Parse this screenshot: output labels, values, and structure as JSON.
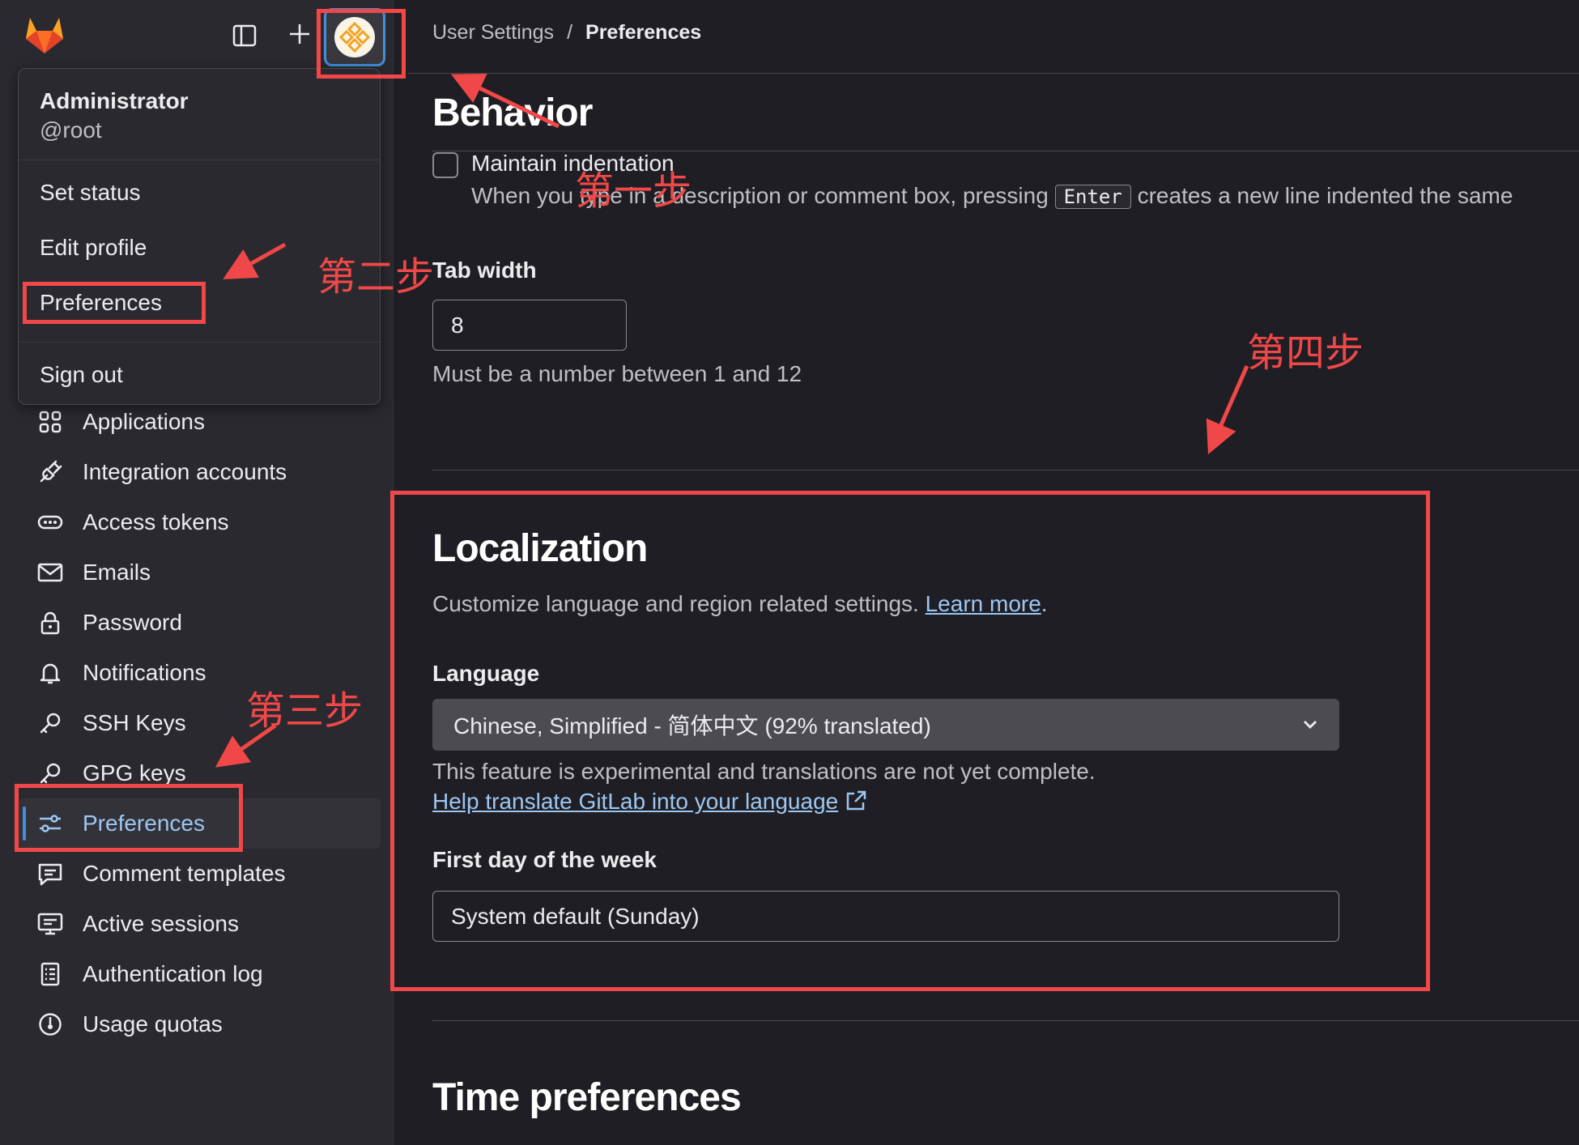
{
  "breadcrumb": {
    "parent": "User Settings",
    "separator": "/",
    "current": "Preferences"
  },
  "user_menu": {
    "name": "Administrator",
    "username": "@root",
    "items": [
      "Set status",
      "Edit profile",
      "Preferences",
      "Sign out"
    ]
  },
  "sidebar": {
    "items": [
      {
        "label": "Applications",
        "icon": "applications-icon"
      },
      {
        "label": "Integration accounts",
        "icon": "plug-icon"
      },
      {
        "label": "Access tokens",
        "icon": "token-icon"
      },
      {
        "label": "Emails",
        "icon": "mail-icon"
      },
      {
        "label": "Password",
        "icon": "lock-icon"
      },
      {
        "label": "Notifications",
        "icon": "bell-icon"
      },
      {
        "label": "SSH Keys",
        "icon": "key-icon"
      },
      {
        "label": "GPG keys",
        "icon": "key-icon"
      },
      {
        "label": "Preferences",
        "icon": "preferences-icon",
        "active": true
      },
      {
        "label": "Comment templates",
        "icon": "comment-icon"
      },
      {
        "label": "Active sessions",
        "icon": "monitor-icon"
      },
      {
        "label": "Authentication log",
        "icon": "log-icon"
      },
      {
        "label": "Usage quotas",
        "icon": "quota-icon"
      }
    ]
  },
  "behavior": {
    "title": "Behavior",
    "maintain_indentation": {
      "label": "Maintain indentation",
      "checked": false,
      "help_before": "When you type in a description or comment box, pressing",
      "key": "Enter",
      "help_after": "creates a new line indented the same"
    },
    "tab_width": {
      "label": "Tab width",
      "value": "8",
      "help": "Must be a number between 1 and 12"
    }
  },
  "localization": {
    "title": "Localization",
    "description": "Customize language and region related settings.",
    "learn_more": "Learn more",
    "period": ".",
    "language": {
      "label": "Language",
      "selected": "Chinese, Simplified - 简体中文 (92% translated)",
      "note": "This feature is experimental and translations are not yet complete.",
      "help_link": "Help translate GitLab into your language"
    },
    "first_day": {
      "label": "First day of the week",
      "selected": "System default (Sunday)"
    }
  },
  "time_preferences": {
    "title": "Time preferences"
  },
  "annotations": {
    "step1": "第一步",
    "step2": "第二步",
    "step3": "第三步",
    "step4": "第四步",
    "color": "#f04848"
  },
  "colors": {
    "accent": "#428fdc",
    "link": "#9dc7f1",
    "annotation": "#f04848",
    "brand": "#fc6d26"
  }
}
